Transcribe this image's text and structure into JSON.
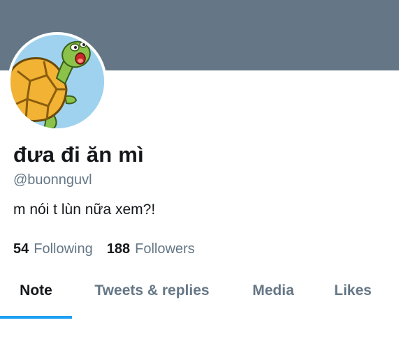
{
  "profile": {
    "display_name": "đưa đi ăn mì",
    "handle": "@buonnguvl",
    "bio": "m nói t lùn nữa xem?!",
    "avatar_icon": "turtle-cartoon-avatar",
    "banner_color": "#657786"
  },
  "stats": {
    "following_count": "54",
    "following_label": "Following",
    "followers_count": "188",
    "followers_label": "Followers"
  },
  "tabs": [
    {
      "label": "Note",
      "active": true
    },
    {
      "label": "Tweets & replies",
      "active": false
    },
    {
      "label": "Media",
      "active": false
    },
    {
      "label": "Likes",
      "active": false
    }
  ],
  "colors": {
    "accent": "#1da1f2",
    "text_primary": "#14171a",
    "text_secondary": "#657786"
  }
}
